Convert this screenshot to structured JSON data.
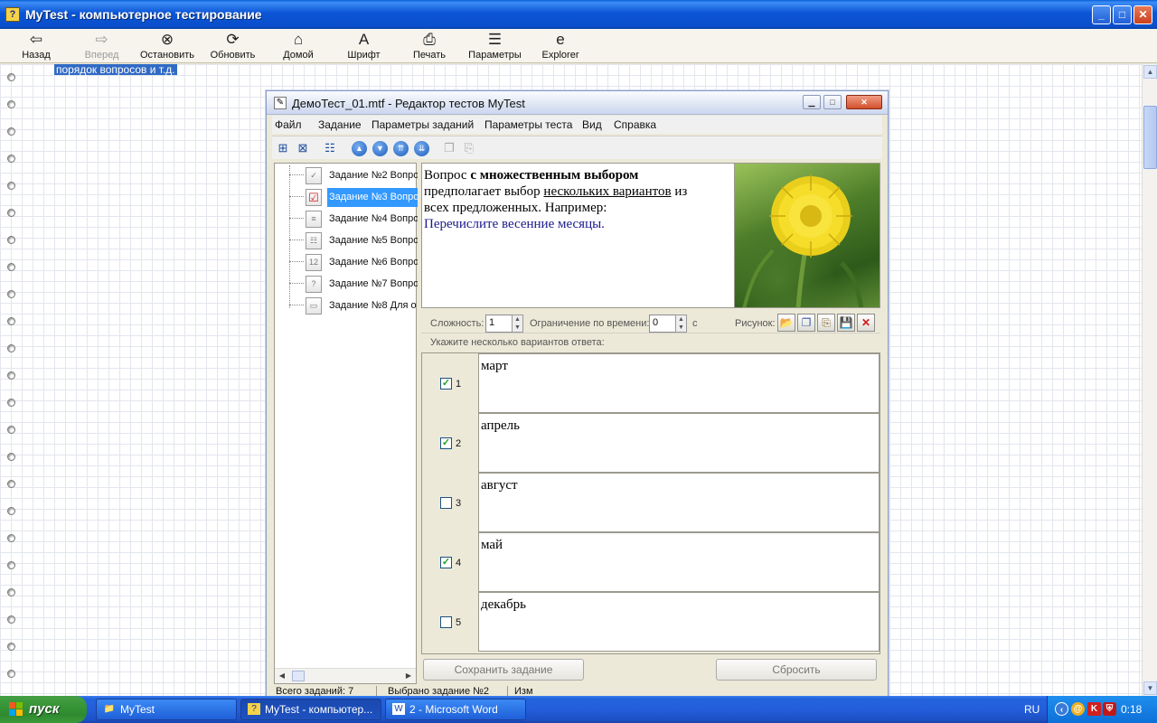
{
  "main_window": {
    "title": "MyTest - компьютерное тестирование",
    "toolbar": [
      {
        "label": "Назад",
        "icon": "back-arrow-icon",
        "glyph": "⇦",
        "disabled": false
      },
      {
        "label": "Вперед",
        "icon": "forward-arrow-icon",
        "glyph": "⇨",
        "disabled": true
      },
      {
        "label": "Остановить",
        "icon": "stop-icon",
        "glyph": "⊗",
        "disabled": false
      },
      {
        "label": "Обновить",
        "icon": "refresh-icon",
        "glyph": "⟳",
        "disabled": false
      },
      {
        "label": "Домой",
        "icon": "home-icon",
        "glyph": "⌂",
        "disabled": false
      },
      {
        "label": "Шрифт",
        "icon": "font-icon",
        "glyph": "A",
        "disabled": false
      },
      {
        "label": "Печать",
        "icon": "printer-icon",
        "glyph": "⎙",
        "disabled": false
      },
      {
        "label": "Параметры",
        "icon": "settings-icon",
        "glyph": "☰",
        "disabled": false
      },
      {
        "label": "Explorer",
        "icon": "explorer-icon",
        "glyph": "e",
        "disabled": false
      }
    ],
    "highlighted_text": "порядок вопросов и т.д."
  },
  "editor": {
    "title": "ДемоТест_01.mtf - Редактор тестов MyTest",
    "menu": [
      "Файл",
      "Задание",
      "Параметры заданий",
      "Параметры теста",
      "Вид",
      "Справка"
    ],
    "tree": [
      {
        "label": "Задание №2 Вопрос",
        "icon": "single-choice-icon",
        "selected": false
      },
      {
        "label": "Задание №3 Вопрос",
        "icon": "multiple-choice-icon",
        "selected": true
      },
      {
        "label": "Задание №4 Вопрос",
        "icon": "ordering-icon",
        "selected": false
      },
      {
        "label": "Задание №5 Вопрос",
        "icon": "matching-icon",
        "selected": false
      },
      {
        "label": "Задание №6 Вопрос",
        "icon": "numeric-input-icon",
        "selected": false
      },
      {
        "label": "Задание №7 Вопрос",
        "icon": "question-icon",
        "selected": false
      },
      {
        "label": "Задание №8 Для о",
        "icon": "text-input-icon",
        "selected": false
      }
    ],
    "question": {
      "p1": "Вопрос ",
      "p1_bold": "с множественным выбором",
      "p2": "предполагает выбор ",
      "p2_u": "нескольких вариантов",
      "p2_end": " из",
      "p3": "всех предложенных. Например:",
      "example": "Перечислите весенние месяцы."
    },
    "params": {
      "difficulty_label": "Сложность:",
      "difficulty_value": "1",
      "time_limit_label": "Ограничение по времени:",
      "time_limit_value": "0",
      "time_unit": "с",
      "picture_label": "Рисунок:"
    },
    "answers_header": "Укажите несколько вариантов ответа:",
    "answers": [
      {
        "num": "1",
        "text": "март",
        "checked": true
      },
      {
        "num": "2",
        "text": "апрель",
        "checked": true
      },
      {
        "num": "3",
        "text": "август",
        "checked": false
      },
      {
        "num": "4",
        "text": "май",
        "checked": true
      },
      {
        "num": "5",
        "text": "декабрь",
        "checked": false
      }
    ],
    "buttons": {
      "save": "Сохранить задание",
      "reset": "Сбросить"
    },
    "status": {
      "total": "Всего заданий: 7",
      "selected": "Выбрано задание №2",
      "modified": "Изм"
    }
  },
  "taskbar": {
    "start": "пуск",
    "tasks": [
      {
        "label": "MyTest",
        "icon": "folder-icon",
        "active": false
      },
      {
        "label": "MyTest - компьютер...",
        "icon": "mytest-app-icon",
        "active": true
      },
      {
        "label": "2 - Microsoft Word",
        "icon": "word-icon",
        "active": false
      }
    ],
    "lang": "RU",
    "clock": "0:18"
  },
  "colors": {
    "xp_blue": "#0a4fcc",
    "selection": "#3399ff",
    "check_green": "#21a121"
  }
}
